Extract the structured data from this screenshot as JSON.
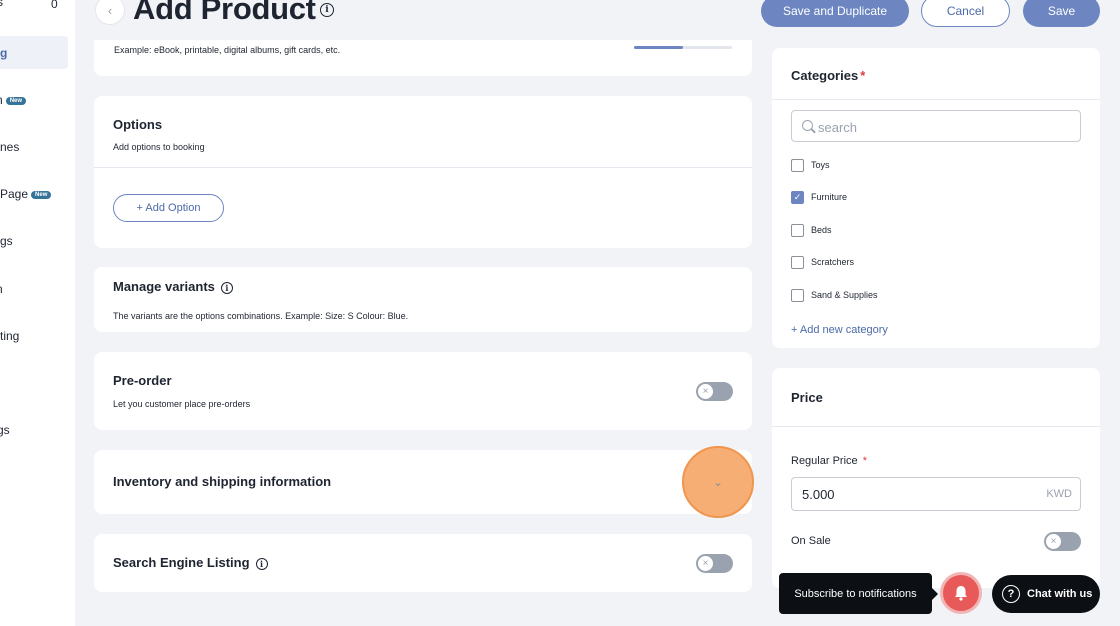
{
  "sidebar": {
    "count": "0",
    "items": [
      {
        "label": "s"
      },
      {
        "label": "g"
      },
      {
        "label": "n",
        "badge": "New"
      },
      {
        "label": "nes"
      },
      {
        "label": "Page",
        "badge": "New"
      },
      {
        "label": "gs"
      },
      {
        "label": "n"
      },
      {
        "label": "ting"
      },
      {
        "label": "gs"
      }
    ]
  },
  "header": {
    "title": "Add Product",
    "save_duplicate_label": "Save and Duplicate",
    "cancel_label": "Cancel",
    "save_label": "Save"
  },
  "digital_card": {
    "subtitle": "Example: eBook, printable, digital albums, gift cards, etc."
  },
  "options": {
    "title": "Options",
    "subtitle": "Add options to booking",
    "add_button": "+ Add Option"
  },
  "variants": {
    "title": "Manage variants",
    "subtitle": "The variants are the options combinations. Example: Size: S Colour: Blue."
  },
  "preorder": {
    "title": "Pre-order",
    "subtitle": "Let you customer place pre-orders",
    "enabled": false
  },
  "inventory": {
    "title": "Inventory and shipping information"
  },
  "seo": {
    "title": "Search Engine Listing",
    "enabled": false
  },
  "categories": {
    "title": "Categories",
    "required_mark": "*",
    "search_placeholder": "search",
    "items": [
      {
        "label": "Toys",
        "checked": false
      },
      {
        "label": "Furniture",
        "checked": true
      },
      {
        "label": "Beds",
        "checked": false
      },
      {
        "label": "Scratchers",
        "checked": false
      },
      {
        "label": "Sand & Supplies",
        "checked": false
      }
    ],
    "add_label": "+ Add new category"
  },
  "price": {
    "title": "Price",
    "regular_label": "Regular Price",
    "required_mark": "*",
    "regular_value": "5.000",
    "currency": "KWD",
    "on_sale_label": "On Sale",
    "on_sale_enabled": false
  },
  "notifications": {
    "tooltip": "Subscribe to notifications"
  },
  "chat": {
    "label": "Chat with us"
  },
  "colors": {
    "accent": "#6d86c2",
    "accent_text": "#4c6aa8",
    "required": "#e03b3b",
    "highlight": "#f7ae74"
  },
  "icons": [
    "chevron-left-icon",
    "info-icon",
    "search-icon",
    "check-icon",
    "chevron-down-icon",
    "bell-icon",
    "help-icon",
    "close-icon"
  ]
}
